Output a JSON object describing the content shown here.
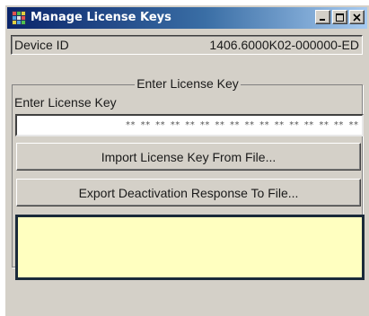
{
  "window": {
    "title": "Manage License Keys",
    "icon": "app-grid-icon",
    "controls": [
      "minimize-icon",
      "maximize-icon",
      "close-icon"
    ]
  },
  "device": {
    "label": "Device ID",
    "value": "1406.6000K02-000000-ED"
  },
  "license_group": {
    "title": "Enter License Key",
    "key_label": "Enter License Key",
    "key_value": "** ** ** ** ** ** ** ** ** ** ** ** ** ** ** **",
    "import_button": "Import License Key From File...",
    "export_button": "Export Deactivation Response To File..."
  },
  "response": {
    "text": ""
  },
  "colors": {
    "titlebar_start": "#0a246a",
    "titlebar_end": "#a6caf0",
    "window_face": "#d4d0c8",
    "response_bg": "#ffffc0"
  }
}
